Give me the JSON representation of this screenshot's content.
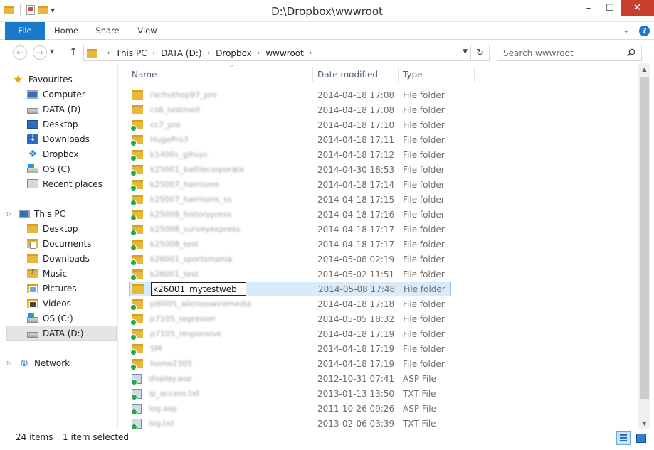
{
  "window": {
    "title": "D:\\Dropbox\\wwwroot",
    "minimize": "–",
    "maximize": "☐",
    "close": "✕"
  },
  "ribbon": {
    "tabs": [
      {
        "label": "File"
      },
      {
        "label": "Home"
      },
      {
        "label": "Share"
      },
      {
        "label": "View"
      }
    ],
    "expand_glyph": "⌄",
    "help_glyph": "?"
  },
  "address": {
    "breadcrumbs": [
      "This PC",
      "DATA (D:)",
      "Dropbox",
      "wwwroot"
    ],
    "search_placeholder": "Search wwwroot"
  },
  "nav": {
    "favourites": {
      "label": "Favourites",
      "items": [
        {
          "label": "Computer",
          "icon": "computer-icon"
        },
        {
          "label": "DATA (D)",
          "icon": "drive-icon"
        },
        {
          "label": "Desktop",
          "icon": "desktop-icon"
        },
        {
          "label": "Downloads",
          "icon": "downloads-icon"
        },
        {
          "label": "Dropbox",
          "icon": "dropbox-icon"
        },
        {
          "label": "OS (C)",
          "icon": "os-drive-icon"
        },
        {
          "label": "Recent places",
          "icon": "recent-places-icon"
        }
      ]
    },
    "thispc": {
      "label": "This PC",
      "items": [
        {
          "label": "Desktop",
          "icon": "desktop-folder-icon"
        },
        {
          "label": "Documents",
          "icon": "documents-folder-icon"
        },
        {
          "label": "Downloads",
          "icon": "downloads-folder-icon"
        },
        {
          "label": "Music",
          "icon": "music-folder-icon"
        },
        {
          "label": "Pictures",
          "icon": "pictures-folder-icon"
        },
        {
          "label": "Videos",
          "icon": "videos-folder-icon"
        },
        {
          "label": "OS (C:)",
          "icon": "os-drive-icon"
        },
        {
          "label": "DATA (D:)",
          "icon": "drive-icon"
        }
      ]
    },
    "network": {
      "label": "Network"
    }
  },
  "columns": {
    "name": "Name",
    "date": "Date modified",
    "type": "Type"
  },
  "files": [
    {
      "name": "rachuthop97_pro",
      "date": "2014-04-18 17:08",
      "type": "File folder",
      "kind": "folder",
      "synced": false
    },
    {
      "name": "cs6_testmeit",
      "date": "2014-04-18 17:08",
      "type": "File folder",
      "kind": "folder",
      "synced": false
    },
    {
      "name": "cc7_pro",
      "date": "2014-04-18 17:10",
      "type": "File folder",
      "kind": "folder",
      "synced": true
    },
    {
      "name": "HugePro3",
      "date": "2014-04-18 17:11",
      "type": "File folder",
      "kind": "folder",
      "synced": true
    },
    {
      "name": "k1400s_glhsys",
      "date": "2014-04-18 17:12",
      "type": "File folder",
      "kind": "folder",
      "synced": true
    },
    {
      "name": "k25001_battlecorporate",
      "date": "2014-04-30 18:53",
      "type": "File folder",
      "kind": "folder",
      "synced": true
    },
    {
      "name": "k25007_harrisons",
      "date": "2014-04-18 17:14",
      "type": "File folder",
      "kind": "folder",
      "synced": true
    },
    {
      "name": "k25007_harrisons_ss",
      "date": "2014-04-18 17:15",
      "type": "File folder",
      "kind": "folder",
      "synced": true
    },
    {
      "name": "k25008_historypress",
      "date": "2014-04-18 17:16",
      "type": "File folder",
      "kind": "folder",
      "synced": true
    },
    {
      "name": "k25008_surveyexpress",
      "date": "2014-04-18 17:17",
      "type": "File folder",
      "kind": "folder",
      "synced": true
    },
    {
      "name": "k25008_test",
      "date": "2014-04-18 17:17",
      "type": "File folder",
      "kind": "folder",
      "synced": true
    },
    {
      "name": "k26001_sportsmania",
      "date": "2014-05-08 02:19",
      "type": "File folder",
      "kind": "folder",
      "synced": true
    },
    {
      "name": "k26001_test",
      "date": "2014-05-02 11:51",
      "type": "File folder",
      "kind": "folder",
      "synced": true
    },
    {
      "name": "k26001_mytestweb",
      "date": "2014-05-08 17:48",
      "type": "File folder",
      "kind": "folder",
      "synced": false,
      "renaming": true
    },
    {
      "name": "pl6005_allcrosswiremedia",
      "date": "2014-04-18 17:18",
      "type": "File folder",
      "kind": "folder",
      "synced": true
    },
    {
      "name": "p7105_regresser",
      "date": "2014-05-05 18:32",
      "type": "File folder",
      "kind": "folder",
      "synced": true
    },
    {
      "name": "p7105_responsive",
      "date": "2014-04-18 17:19",
      "type": "File folder",
      "kind": "folder",
      "synced": true
    },
    {
      "name": "SM",
      "date": "2014-04-18 17:19",
      "type": "File folder",
      "kind": "folder",
      "synced": true
    },
    {
      "name": "home2305",
      "date": "2014-04-18 17:19",
      "type": "File folder",
      "kind": "folder",
      "synced": true
    },
    {
      "name": "display.asp",
      "date": "2012-10-31 07:41",
      "type": "ASP File",
      "kind": "file",
      "synced": true
    },
    {
      "name": "ip_access.txt",
      "date": "2013-01-13 13:50",
      "type": "TXT File",
      "kind": "file",
      "synced": true
    },
    {
      "name": "log.asp",
      "date": "2011-10-26 09:26",
      "type": "ASP File",
      "kind": "file",
      "synced": true
    },
    {
      "name": "log.txt",
      "date": "2013-02-06 03:39",
      "type": "TXT File",
      "kind": "file",
      "synced": true
    }
  ],
  "status": {
    "count": "24 items",
    "selected": "1 item selected"
  }
}
